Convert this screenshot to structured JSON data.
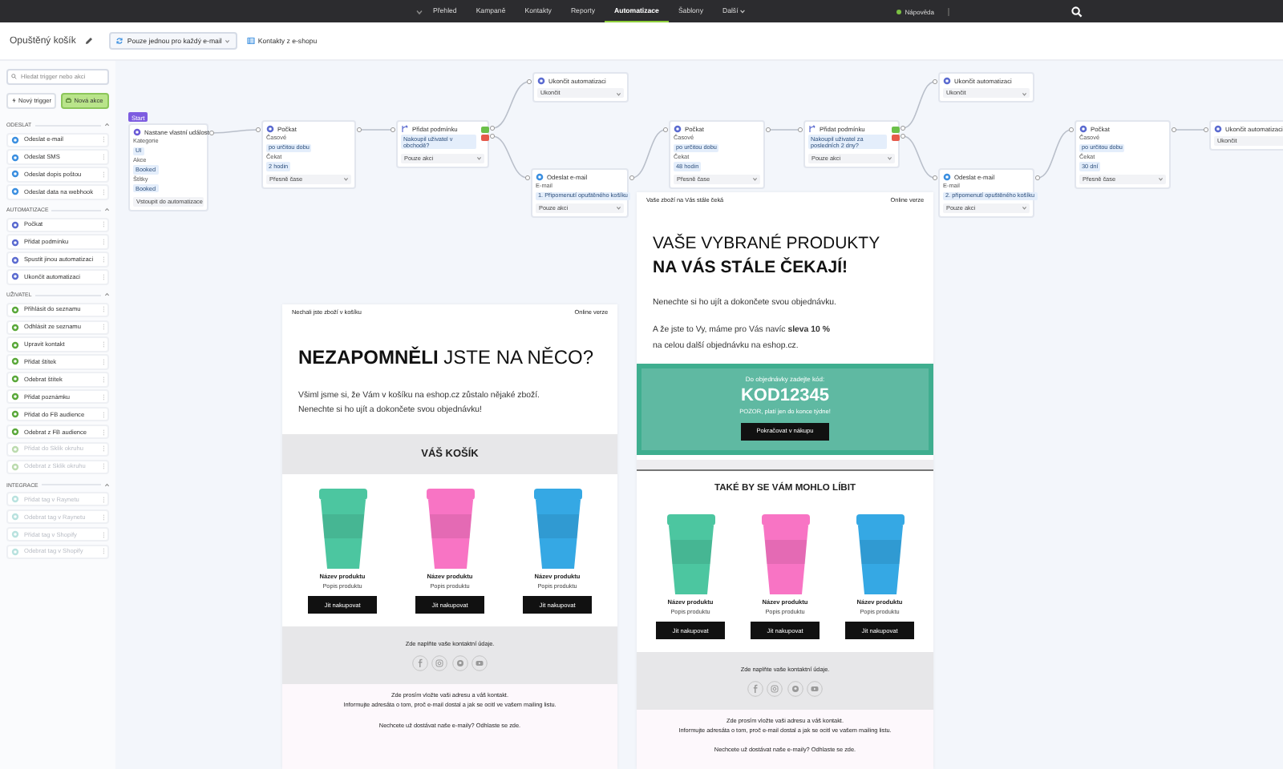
{
  "nav": {
    "items": [
      {
        "label": "Přehled",
        "selected": false,
        "has_menu": false
      },
      {
        "label": "Kampaně",
        "selected": false,
        "has_menu": false
      },
      {
        "label": "Kontakty",
        "selected": false,
        "has_menu": false
      },
      {
        "label": "Reporty",
        "selected": false,
        "has_menu": false
      },
      {
        "label": "Automatizace",
        "selected": true,
        "has_menu": false
      },
      {
        "label": "Šablony",
        "selected": false,
        "has_menu": false
      },
      {
        "label": "Další",
        "selected": false,
        "has_menu": true
      }
    ],
    "help": "Nápověda"
  },
  "header": {
    "title": "Opuštěný košík",
    "frequency": "Pouze jednou pro každý e-mail",
    "audience": "Kontakty z e-shopu"
  },
  "sidebar": {
    "search": {
      "placeholder": "Hledat trigger nebo akci"
    },
    "buttons": [
      {
        "label": "Nový trigger",
        "selected": false
      },
      {
        "label": "Nová akce",
        "selected": true
      }
    ],
    "sections": [
      {
        "title": "ODESLAT",
        "expanded": true,
        "items": [
          {
            "label": "Odeslat e-mail",
            "disabled": false
          },
          {
            "label": "Odeslat SMS",
            "disabled": false
          },
          {
            "label": "Odeslat dopis poštou",
            "disabled": false
          },
          {
            "label": "Odeslat data na webhook",
            "disabled": false
          }
        ]
      },
      {
        "title": "AUTOMATIZACE",
        "expanded": true,
        "items": [
          {
            "label": "Počkat",
            "disabled": false
          },
          {
            "label": "Přidat podmínku",
            "disabled": false
          },
          {
            "label": "Spustit jinou automatizaci",
            "disabled": false
          },
          {
            "label": "Ukončit automatizaci",
            "disabled": false
          }
        ]
      },
      {
        "title": "UŽIVATEL",
        "expanded": true,
        "items": [
          {
            "label": "Přihlásit do seznamu",
            "disabled": false
          },
          {
            "label": "Odhlásit ze seznamu",
            "disabled": false
          },
          {
            "label": "Upravit kontakt",
            "disabled": false
          },
          {
            "label": "Přidat štítek",
            "disabled": false
          },
          {
            "label": "Odebrat štítek",
            "disabled": false
          },
          {
            "label": "Přidat poznámku",
            "disabled": false
          },
          {
            "label": "Přidat do FB audience",
            "disabled": false
          },
          {
            "label": "Odebrat z FB audience",
            "disabled": false
          },
          {
            "label": "Přidat do Sklik okruhu",
            "disabled": true
          },
          {
            "label": "Odebrat z Sklik okruhu",
            "disabled": true
          }
        ]
      },
      {
        "title": "INTEGRACE",
        "expanded": true,
        "items": [
          {
            "label": "Přidat tag v Raynetu",
            "disabled": true
          },
          {
            "label": "Odebrat tag v Raynetu",
            "disabled": true
          },
          {
            "label": "Přidat tag v Shopify",
            "disabled": true
          },
          {
            "label": "Odebrat tag v Shopify",
            "disabled": true
          }
        ]
      }
    ]
  },
  "workflow": {
    "nodes": [
      {
        "kind": "trigger",
        "badge": "Start",
        "title": "Nastane vlastní událost",
        "fields": [
          {
            "label": "Kategorie",
            "value": "UI"
          },
          {
            "label": "Akce",
            "value": "Booked"
          },
          {
            "label": "Štítky",
            "value": "Booked"
          }
        ],
        "select": "Vstoupit do automatizace"
      },
      {
        "kind": "wait",
        "title": "Počkat",
        "fields": [
          {
            "label": "Časové",
            "value": "po určitou dobu"
          },
          {
            "label": "Čekat",
            "value": "2 hodin"
          }
        ],
        "select": "Přesně čase"
      },
      {
        "kind": "condition",
        "title": "Přidat podmínku",
        "condition": "Nakoupil uživatel v obchodě?",
        "select": "Pouze akci"
      },
      {
        "kind": "end",
        "title": "Ukončit automatizaci",
        "select": "Ukončit"
      },
      {
        "kind": "email",
        "title": "Odeslat e-mail",
        "fields": [
          {
            "label": "E-mail",
            "value": "1. Připomenutí opuštěného košíku"
          }
        ],
        "select": "Pouze akci"
      },
      {
        "kind": "wait",
        "title": "Počkat",
        "fields": [
          {
            "label": "Časové",
            "value": "po určitou dobu"
          },
          {
            "label": "Čekat",
            "value": "48 hodin"
          }
        ],
        "select": "Přesně čase"
      },
      {
        "kind": "condition",
        "title": "Přidat podmínku",
        "condition": "Nakoupil uživatel za posledních 2 dny?",
        "select": "Pouze akci"
      },
      {
        "kind": "end",
        "title": "Ukončit automatizaci",
        "select": "Ukončit"
      },
      {
        "kind": "email",
        "title": "Odeslat e-mail",
        "fields": [
          {
            "label": "E-mail",
            "value": "2. připomenutí opuštěného košíku"
          }
        ],
        "select": "Pouze akci"
      },
      {
        "kind": "wait",
        "title": "Počkat",
        "fields": [
          {
            "label": "Časové",
            "value": "po určitou dobu"
          },
          {
            "label": "Čekat",
            "value": "30 dní"
          }
        ],
        "select": "Přesně čase"
      },
      {
        "kind": "end",
        "title": "Ukončit automatizaci",
        "select": "Ukončit"
      }
    ]
  },
  "emails": [
    {
      "blocks": [
        {
          "kind": "topbar",
          "left": "Nechali jste zboží v košíku",
          "right": "Online verze"
        },
        {
          "kind": "heading",
          "lines": [
            "**NEZAPOMNĚLI** JSTE NA NĚCO?"
          ]
        },
        {
          "kind": "text",
          "lines": [
            "Všiml jsme si, že Vám v košíku na eshop.cz zůstalo nějaké zboží.",
            "Nenechte si ho ujít a dokončete svou objednávku!"
          ]
        },
        {
          "kind": "band_title",
          "text": "VÁŠ KOŠÍK"
        },
        {
          "kind": "products",
          "items": [
            {
              "name": "Název produktu",
              "description": "Popis produktu",
              "button": "Jít nakupovat",
              "color": "#4cc6a0"
            },
            {
              "name": "Název produktu",
              "description": "Popis produktu",
              "button": "Jít nakupovat",
              "color": "#f874c4"
            },
            {
              "name": "Název produktu",
              "description": "Popis produktu",
              "button": "Jít nakupovat",
              "color": "#35a8e4"
            }
          ]
        },
        {
          "kind": "contact",
          "text": "Zde naplňte vaše kontaktní údaje."
        },
        {
          "kind": "footer",
          "lines": [
            "Zde prosím vložte vaši adresu a váš kontakt.",
            "Informujte adresáta o tom, proč e-mail dostal a jak se ocitl ve vašem mailing listu."
          ],
          "unsubscribe": "Nechcete už dostávat naše e-maily? Odhlaste se zde."
        }
      ]
    },
    {
      "blocks": [
        {
          "kind": "topbar",
          "left": "Vaše zboží na Vás stále čeká",
          "right": "Online verze"
        },
        {
          "kind": "heading",
          "lines": [
            "VAŠE VYBRANÉ PRODUKTY",
            "**NA VÁS STÁLE ČEKAJÍ!**"
          ]
        },
        {
          "kind": "text",
          "lines": [
            "Nenechte si ho ujít a dokončete svou objednávku."
          ]
        },
        {
          "kind": "text",
          "lines": [
            "A že jste to Vy, máme pro Vás navíc **sleva 10 %**",
            "na celou další objednávku na eshop.cz."
          ]
        },
        {
          "kind": "coupon",
          "label": "Do objednávky zadejte kód:",
          "code": "KOD12345",
          "note": "POZOR, platí jen do konce týdne!",
          "button": "Pokračovat v nákupu"
        },
        {
          "kind": "divider"
        },
        {
          "kind": "section_title",
          "text": "TAKÉ BY SE VÁM MOHLO LÍBIT"
        },
        {
          "kind": "products",
          "items": [
            {
              "name": "Název produktu",
              "description": "Popis produktu",
              "button": "Jít nakupovat",
              "color": "#4cc6a0"
            },
            {
              "name": "Název produktu",
              "description": "Popis produktu",
              "button": "Jít nakupovat",
              "color": "#f874c4"
            },
            {
              "name": "Název produktu",
              "description": "Popis produktu",
              "button": "Jít nakupovat",
              "color": "#35a8e4"
            }
          ]
        },
        {
          "kind": "contact",
          "text": "Zde naplňte vaše kontaktní údaje."
        },
        {
          "kind": "footer",
          "lines": [
            "Zde prosím vložte vaši adresu a váš kontakt.",
            "Informujte adresáta o tom, proč e-mail dostal a jak se ocitl ve vašem mailing listu."
          ],
          "unsubscribe": "Nechcete už dostávat naše e-maily? Odhlaste se zde."
        }
      ]
    }
  ]
}
